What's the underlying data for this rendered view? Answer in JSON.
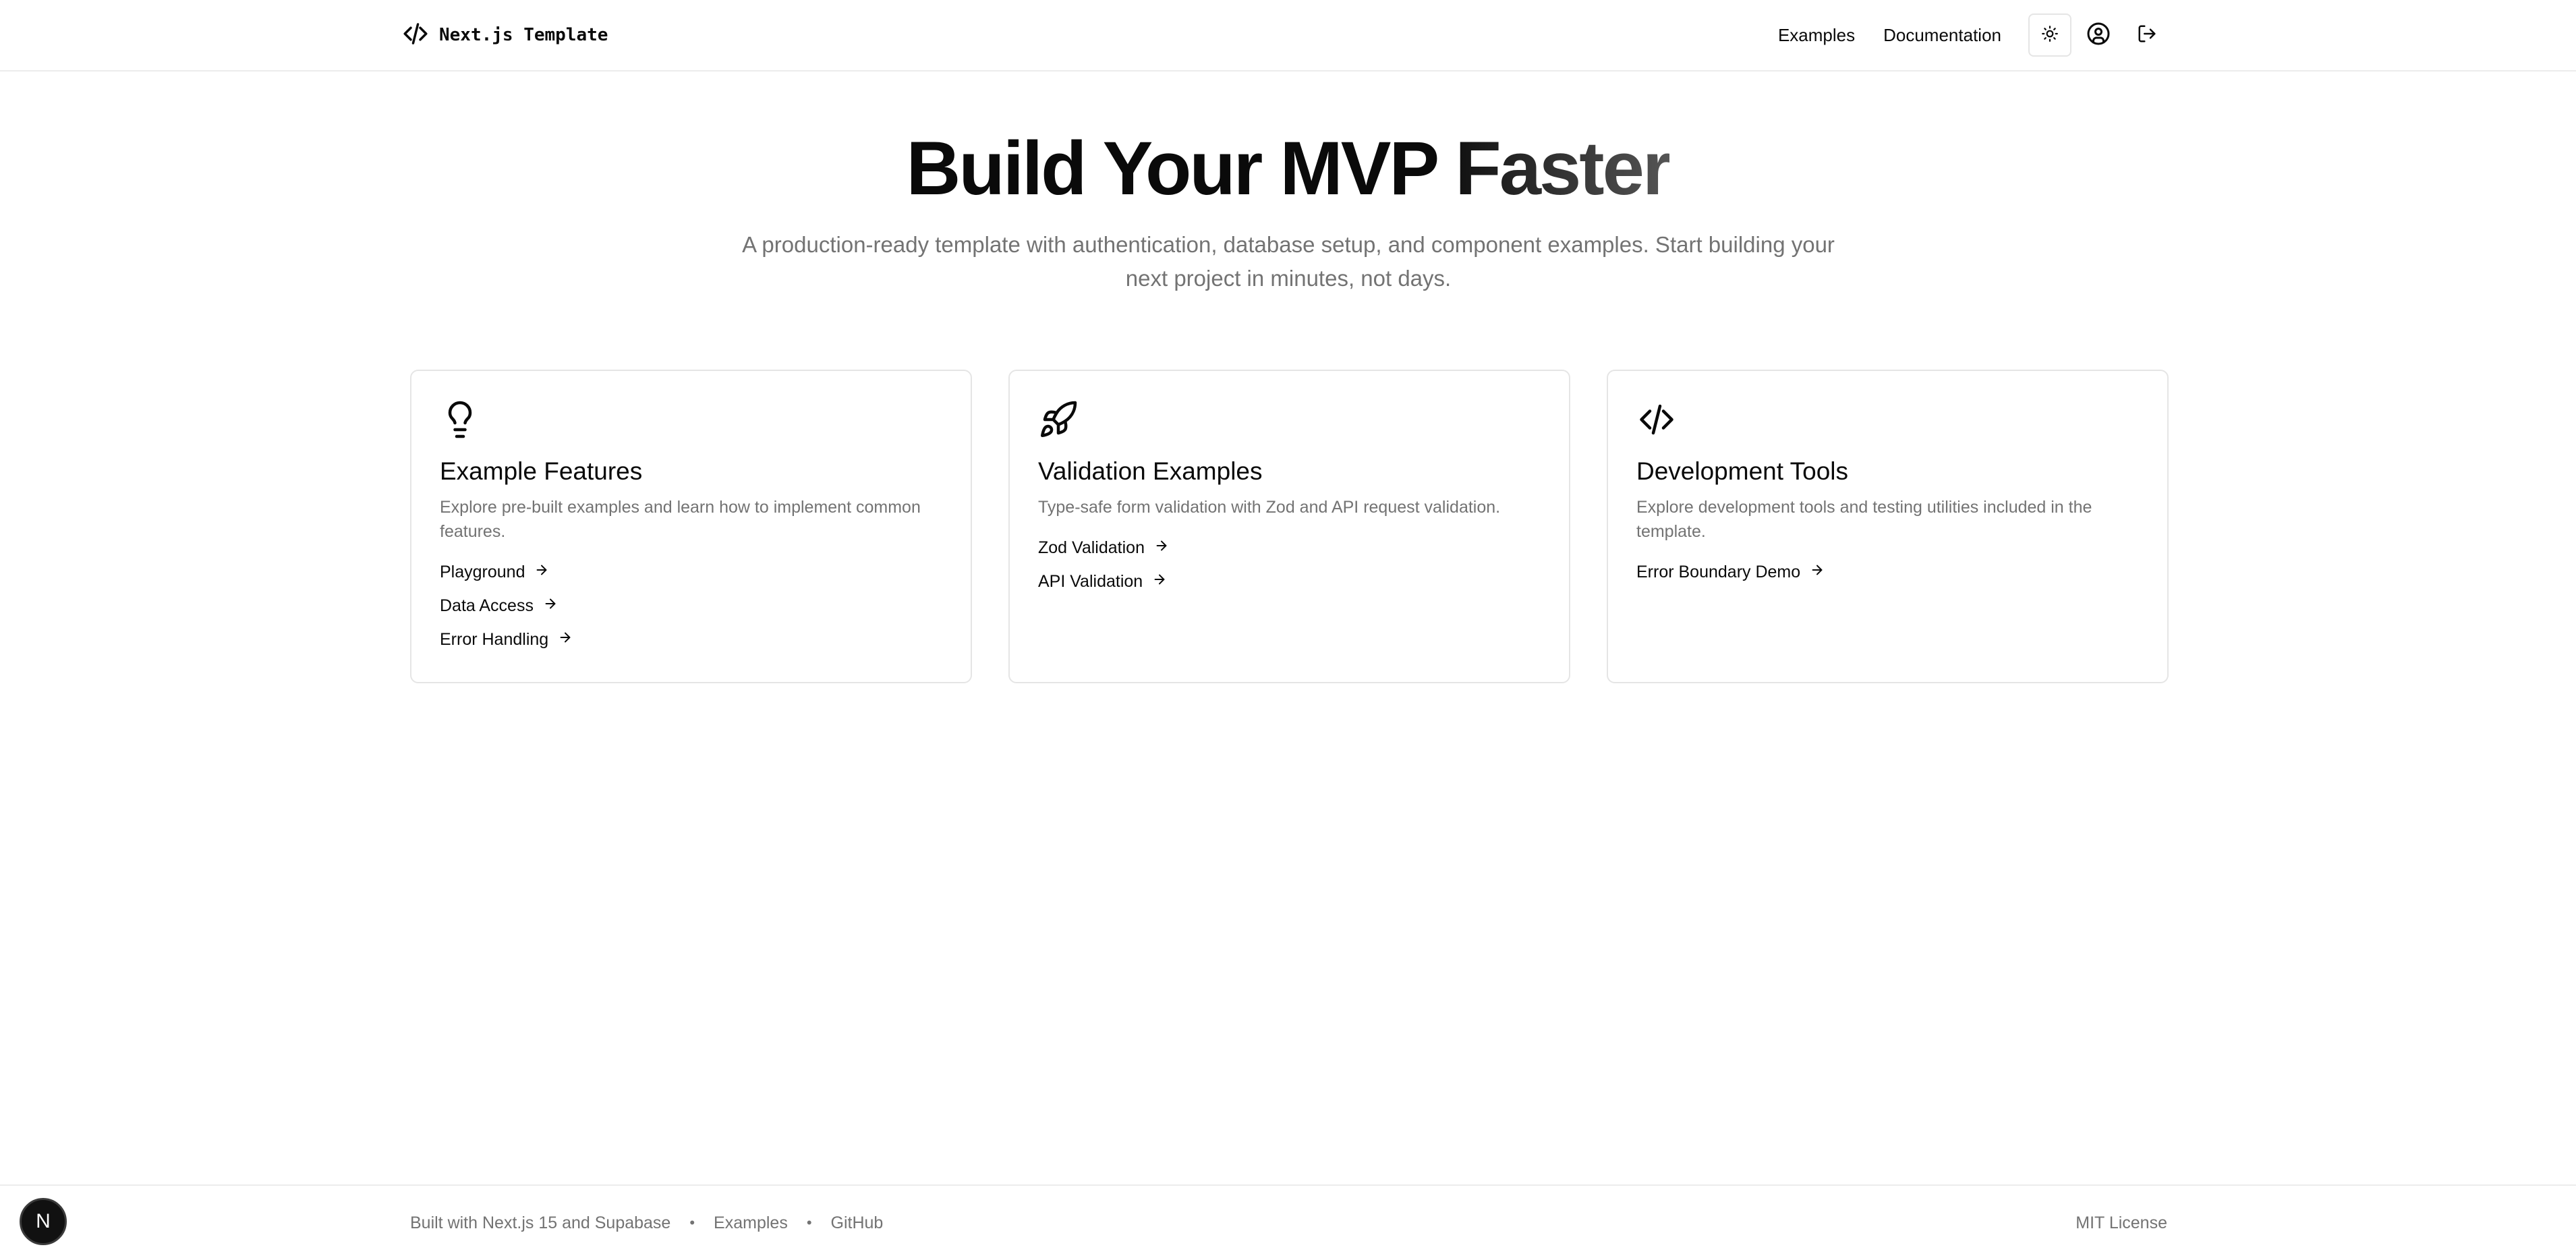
{
  "header": {
    "brand_icon": "code-icon",
    "brand_title": "Next.js Template",
    "nav": {
      "examples_label": "Examples",
      "documentation_label": "Documentation"
    },
    "theme_toggle_icon": "sun-icon",
    "user_icon": "user-circle-icon",
    "logout_icon": "log-out-icon"
  },
  "hero": {
    "title_main": "Build Your MVP ",
    "title_accent": "Faster",
    "subtitle": "A production-ready template with authentication, database setup, and component examples. Start building your next project in minutes, not days."
  },
  "cards": [
    {
      "icon": "lightbulb-icon",
      "title": "Example Features",
      "description": "Explore pre-built examples and learn how to implement common features.",
      "links": [
        "Playground",
        "Data Access",
        "Error Handling"
      ]
    },
    {
      "icon": "rocket-icon",
      "title": "Validation Examples",
      "description": "Type-safe form validation with Zod and API request validation.",
      "links": [
        "Zod Validation",
        "API Validation"
      ]
    },
    {
      "icon": "code-icon",
      "title": "Development Tools",
      "description": "Explore development tools and testing utilities included in the template.",
      "links": [
        "Error Boundary Demo"
      ]
    }
  ],
  "footer": {
    "built_with": "Built with Next.js 15 and Supabase",
    "separator": "•",
    "examples_label": "Examples",
    "github_label": "GitHub",
    "license": "MIT License"
  },
  "dev_badge": {
    "label": "N"
  },
  "colors": {
    "text": "#0a0a0a",
    "muted": "#737373",
    "border": "#e5e5e5",
    "badge_bg": "#111111"
  }
}
